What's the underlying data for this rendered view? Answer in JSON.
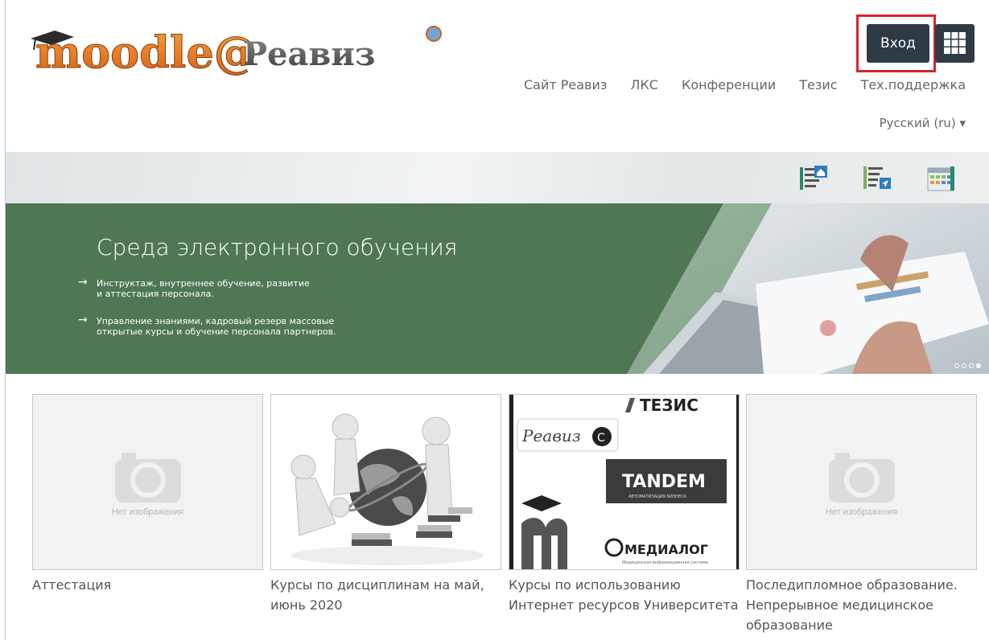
{
  "header": {
    "logo_text": "moodle@Реавиз",
    "login_label": "Вход",
    "nav": [
      "Сайт Реавиз",
      "ЛКС",
      "Конференции",
      "Тезис",
      "Тех.поддержка"
    ],
    "language": "Русский (ru) ▾"
  },
  "iconbar": {
    "icons": [
      "home-dashboard-icon",
      "send-list-icon",
      "calendar-icon"
    ]
  },
  "banner": {
    "title": "Среда электронного обучения",
    "items": [
      "Инструктаж, внутреннее обучение, развитие\nи аттестация персонала.",
      "Управление знаниями, кадровый резерв массовые\nоткрытые курсы и обучение персонала партнеров."
    ],
    "slide_count": 4,
    "active_slide": 4
  },
  "cards": [
    {
      "caption": "Аттестация",
      "image": "no-image",
      "no_image_label": "Нет изображения"
    },
    {
      "caption": "Курсы по дисциплинам на май, июнь 2020",
      "image": "figures-globe"
    },
    {
      "caption": "Курсы по использованию Интернет ресурсов Университета",
      "image": "partner-logos",
      "logo_texts": [
        "ТЕЗИС",
        "Реавиз",
        "TANDEM",
        "АВТОМАТИЗАЦИЯ БИЗНЕСА",
        "МЕДИАЛОГ",
        "Медицинская информационная система"
      ]
    },
    {
      "caption": "Последипломное образование. Непрерывное медицинское образование",
      "image": "no-image",
      "no_image_label": "Нет изображения"
    }
  ],
  "colors": {
    "banner_green": "#4f7754",
    "login_bg": "#2f3b44",
    "highlight_red": "#d9232f",
    "logo_orange": "#e8791f"
  }
}
